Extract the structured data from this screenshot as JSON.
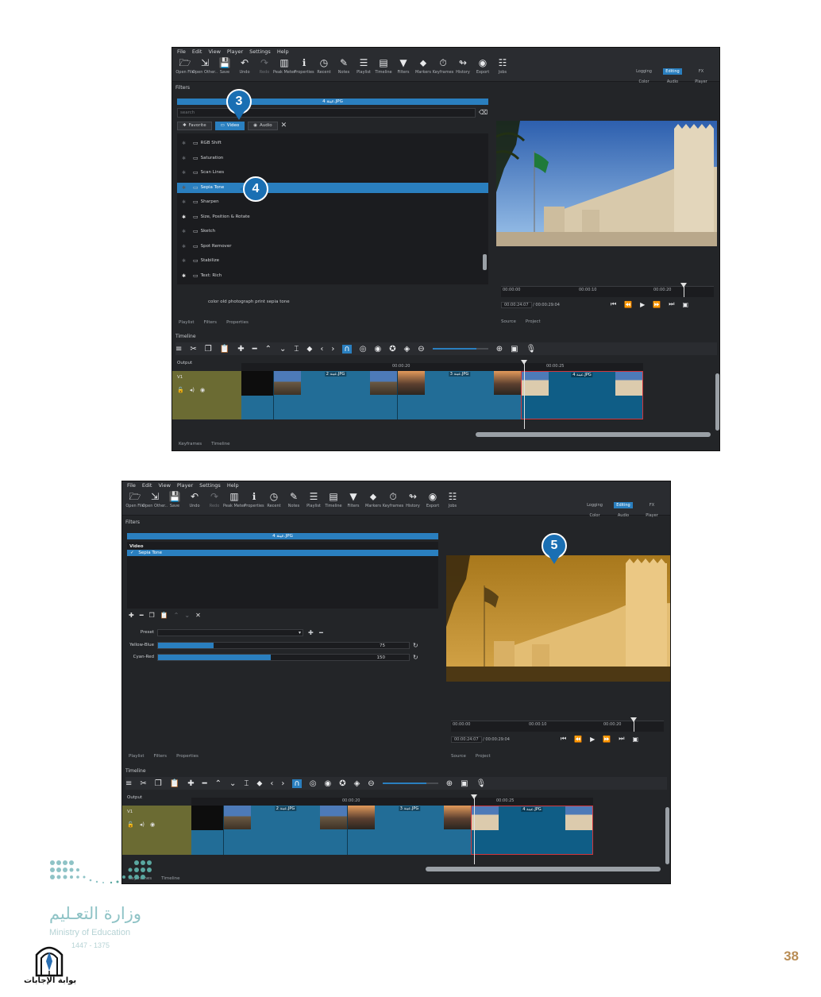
{
  "menu": [
    "File",
    "Edit",
    "View",
    "Player",
    "Settings",
    "Help"
  ],
  "toolbar": [
    {
      "icon": "folder-open-icon",
      "label": "Open File"
    },
    {
      "icon": "open-other-icon",
      "label": "Open Other.."
    },
    {
      "icon": "save-icon",
      "label": "Save"
    },
    {
      "icon": "undo-icon",
      "label": "Undo"
    },
    {
      "icon": "redo-icon",
      "label": "Redo"
    },
    {
      "icon": "peak-meter-icon",
      "label": "Peak Meter"
    },
    {
      "icon": "info-icon",
      "label": "Properties"
    },
    {
      "icon": "clock-icon",
      "label": "Recent"
    },
    {
      "icon": "notes-icon",
      "label": "Notes"
    },
    {
      "icon": "playlist-icon",
      "label": "Playlist"
    },
    {
      "icon": "timeline-icon",
      "label": "Timeline"
    },
    {
      "icon": "funnel-icon",
      "label": "Filters"
    },
    {
      "icon": "marker-icon",
      "label": "Markers"
    },
    {
      "icon": "stopwatch-icon",
      "label": "Keyframes"
    },
    {
      "icon": "history-icon",
      "label": "History"
    },
    {
      "icon": "export-icon",
      "label": "Export"
    },
    {
      "icon": "jobs-icon",
      "label": "Jobs"
    }
  ],
  "layouts": [
    {
      "top": "Logging",
      "bottom": "Color"
    },
    {
      "top": "Editing",
      "bottom": "Audio",
      "active": true
    },
    {
      "top": "FX",
      "bottom": "Player"
    }
  ],
  "screen1": {
    "panel_title": "Filters",
    "file_name": "عينة 4.JPG",
    "search_placeholder": "search",
    "tabs": [
      "Favorite",
      "Video",
      "Audio"
    ],
    "filters": [
      {
        "name": "RGB Shift",
        "fav": false
      },
      {
        "name": "Saturation",
        "fav": false
      },
      {
        "name": "Scan Lines",
        "fav": false
      },
      {
        "name": "Sepia Tone",
        "fav": false,
        "selected": true
      },
      {
        "name": "Sharpen",
        "fav": false
      },
      {
        "name": "Size, Position & Rotate",
        "fav": true
      },
      {
        "name": "Sketch",
        "fav": false
      },
      {
        "name": "Spot Remover",
        "fav": false
      },
      {
        "name": "Stabilize",
        "fav": false
      },
      {
        "name": "Text: Rich",
        "fav": true
      }
    ],
    "description": "color old photograph print sepia tone",
    "bottom_tabs": [
      "Playlist",
      "Filters",
      "Properties"
    ],
    "player_tabs": [
      "Source",
      "Project"
    ],
    "ruler": [
      "00:00:00",
      "00:00:10",
      "00:00:20"
    ],
    "timecode": "00:00:24:07",
    "duration": "/ 00:00:29:04",
    "callout_a": "3",
    "callout_b": "4"
  },
  "screen2": {
    "panel_title": "Filters",
    "file_name": "عينة 4.JPG",
    "group": "Video",
    "applied": "Sepia Tone",
    "preset_label": "Preset",
    "params": [
      {
        "label": "Yellow-Blue",
        "value": 75,
        "fraction": 0.22
      },
      {
        "label": "Cyan-Red",
        "value": 150,
        "fraction": 0.45
      }
    ],
    "bottom_tabs": [
      "Playlist",
      "Filters",
      "Properties"
    ],
    "player_tabs": [
      "Source",
      "Project"
    ],
    "ruler": [
      "00:00:00",
      "00:00:10",
      "00:00:20"
    ],
    "timecode": "00:00:24:07",
    "duration": "/ 00:00:29:04",
    "callout": "5"
  },
  "timeline": {
    "title": "Timeline",
    "output": "Output",
    "track": "V1",
    "ruler": [
      "00:00:20",
      "00:00:25"
    ],
    "clips": [
      "عينة 2.JPG",
      "عينة 3.JPG",
      "عينة 4.JPG"
    ],
    "bottom_tabs": [
      "Keyframes",
      "Timeline"
    ]
  },
  "footer": {
    "ministry_ar": "وزارة التعـليم",
    "ministry_en": "Ministry of Education",
    "years": "1447 - 1375",
    "gate": "بوابة الإجابات",
    "page": "38"
  },
  "colors": {
    "accent": "#2a7fbf",
    "callout": "#1a6fb3",
    "page_num": "#b98d55"
  }
}
